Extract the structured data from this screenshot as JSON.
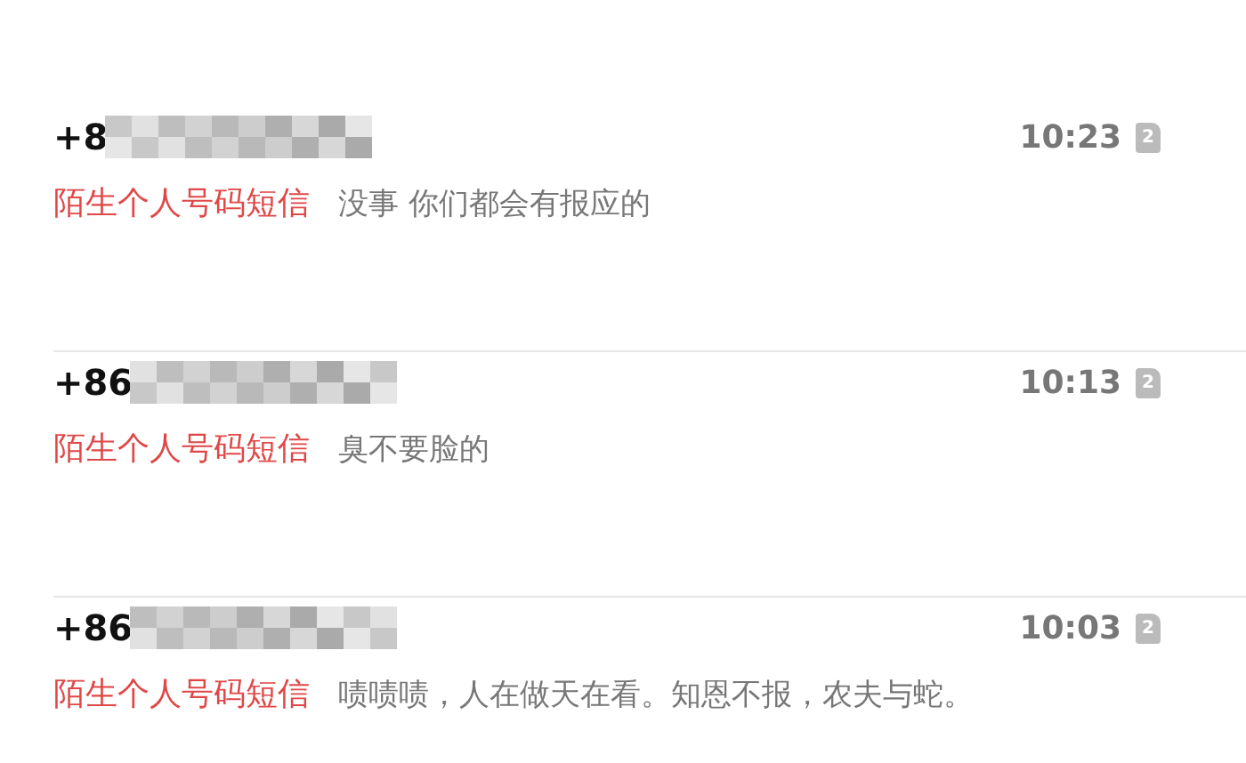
{
  "messages": [
    {
      "sender": "+8",
      "time": "10:23",
      "sim": "2",
      "tag": "陌生个人号码短信",
      "preview": "没事 你们都会有报应的"
    },
    {
      "sender": "+86",
      "time": "10:13",
      "sim": "2",
      "tag": "陌生个人号码短信",
      "preview": "臭不要脸的"
    },
    {
      "sender": "+86",
      "time": "10:03",
      "sim": "2",
      "tag": "陌生个人号码短信",
      "preview": "啧啧啧，人在做天在看。知恩不报，农夫与蛇。"
    }
  ]
}
